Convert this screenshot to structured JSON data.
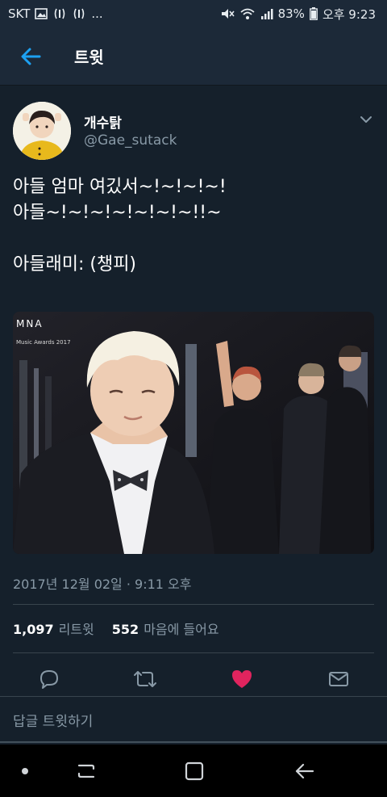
{
  "status_bar": {
    "carrier": "SKT",
    "extra": "...",
    "battery": "83%",
    "time": "오후 9:23"
  },
  "app_bar": {
    "title": "트윗"
  },
  "tweet": {
    "author_name": "개수탉",
    "author_handle": "@Gae_sutack",
    "text_lines": [
      "아들 엄마 여깄서~!~!~!~!",
      "아들~!~!~!~!~!~!~!!~",
      "",
      "아들래미: (챙피)"
    ],
    "media": {
      "logo": "MNA",
      "caption": "Music Awards 2017"
    },
    "timestamp": "2017년 12월 02일 · 9:11 오후",
    "retweet_count": "1,097",
    "retweet_label": "리트윗",
    "like_count": "552",
    "like_label": "마음에 들어요"
  },
  "reply": {
    "placeholder": "답글 트윗하기"
  },
  "colors": {
    "background": "#15202b",
    "bar": "#1c2938",
    "accent": "#1da1f2",
    "like": "#e0245e",
    "muted": "#8899a6"
  },
  "icons": {
    "back": "arrow-left-icon",
    "reply": "speech-bubble-icon",
    "retweet": "retweet-icon",
    "like": "heart-icon",
    "message": "envelope-icon"
  }
}
